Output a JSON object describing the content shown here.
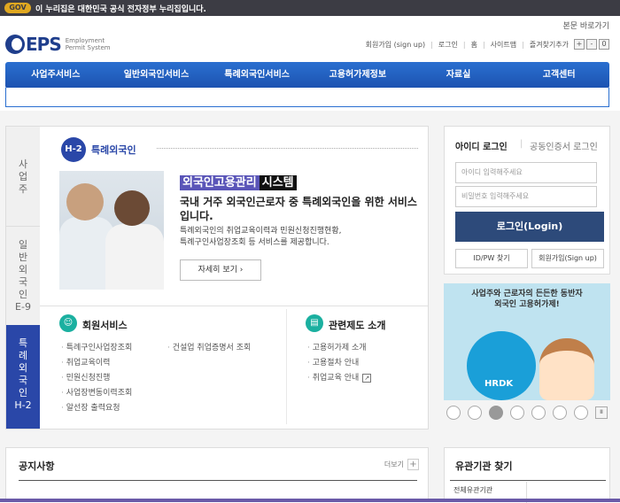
{
  "gov_banner": {
    "emblem": "GOV",
    "text": "이 누리집은 대한민국 공식 전자정부 누리집입니다."
  },
  "skip_link": "본문 바로가기",
  "logo": {
    "name": "EPS",
    "sub_line1": "Employment",
    "sub_line2": "Permit System"
  },
  "util": {
    "signup": "회원가입 (sign up)",
    "login": "로그인",
    "home": "홈",
    "sitemap": "사이트맵",
    "favorite": "즐겨찾기추가",
    "zoom_in": "+",
    "zoom_out": "-",
    "zoom_reset": "0"
  },
  "nav": [
    {
      "label": "사업주서비스"
    },
    {
      "label": "일반외국인서비스"
    },
    {
      "label": "특례외국인서비스"
    },
    {
      "label": "고용허가제정보"
    },
    {
      "label": "자료실"
    },
    {
      "label": "고객센터"
    }
  ],
  "vtabs": [
    {
      "label": "사\n업\n주"
    },
    {
      "label": "일\n반\n외\n국\n인\nE-9"
    },
    {
      "label": "특\n례\n외\n국\n인\nH-2"
    }
  ],
  "h2": {
    "badge": "H-2",
    "title": "특례외국인"
  },
  "headline": {
    "part_a": "외국인고용관리",
    "part_b": "시스템",
    "sub": "국내 거주 외국인근로자 중 특례외국인을 위한 서비스입니다.",
    "desc_line1": "특례외국인의 취업교육이력과 민원신청진행현황,",
    "desc_line2": "특례구인사업장조회 등 서비스를 제공합니다.",
    "detail_button": "자세히 보기  ›"
  },
  "member_services": {
    "title": "회원서비스",
    "col1": [
      "특례구인사업장조회",
      "취업교육이력",
      "민원신청진행",
      "사업장변동이력조회",
      "알선장 출력요청"
    ],
    "col2": [
      "건설업 취업증명서 조회"
    ]
  },
  "related": {
    "title": "관련제도 소개",
    "items": [
      "고용허가제 소개",
      "고용절차 안내",
      "취업교육 안내"
    ]
  },
  "login": {
    "tab_id": "아이디 로그인",
    "tab_cert": "공동인증서 로그인",
    "id_placeholder": "아이디 입력해주세요",
    "pw_placeholder": "비밀번호 입력해주세요",
    "login_button": "로그인(Login)",
    "find_button": "ID/PW 찾기",
    "signup_button": "회원가입(Sign up)"
  },
  "promo": {
    "line1": "사업주와 근로자의 든든한 동반자",
    "line2": "외국인 고용허가제!",
    "mascot_label": "HRDK"
  },
  "carousel": {
    "dots": 7,
    "active_index": 2,
    "pause": "II"
  },
  "notice": {
    "title": "공지사항",
    "more": "더보기",
    "plus": "+"
  },
  "agency": {
    "title": "유관기관 찾기",
    "label": "전체유관기관"
  },
  "colors": {
    "nav_blue": "#1c52b0",
    "brand_navy": "#1f3e8c",
    "vtab_active": "#2a47a8",
    "login_button": "#2d4a7a",
    "teal": "#1bb0a0"
  }
}
